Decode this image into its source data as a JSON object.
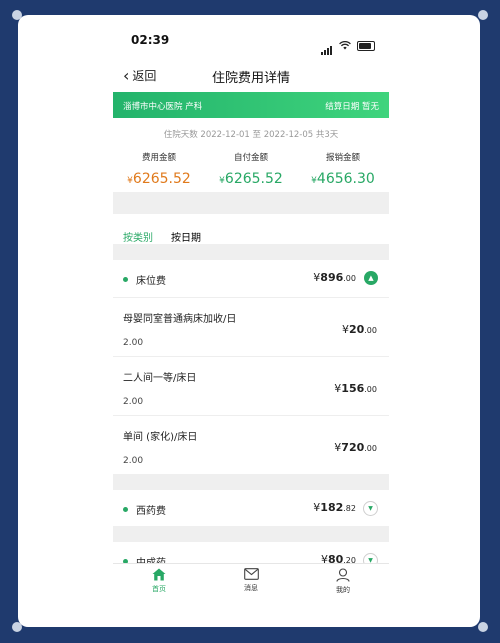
{
  "status": {
    "time": "02:39"
  },
  "nav": {
    "back_label": "返回",
    "title": "住院费用详情"
  },
  "hospital": {
    "name": "淄博市中心医院 产科",
    "settle_label": "结算日期 暂无"
  },
  "stay_info": "住院天数 2022-12-01 至 2022-12-05 共3天",
  "summary": [
    {
      "label": "费用金额",
      "currency": "¥",
      "value": "6265.52",
      "color": "#e07a1c"
    },
    {
      "label": "自付金额",
      "currency": "¥",
      "value": "6265.52",
      "color": "#28a865"
    },
    {
      "label": "报销金额",
      "currency": "¥",
      "value": "4656.30",
      "color": "#28a865"
    }
  ],
  "tabs": [
    {
      "label": "按类别",
      "active": true
    },
    {
      "label": "按日期",
      "active": false
    }
  ],
  "categories": [
    {
      "name": "床位费",
      "currency": "¥",
      "int": "896",
      "dec": ".00",
      "expanded": true,
      "items": [
        {
          "name": "母婴同室普通病床加收/日",
          "qty": "2.00",
          "currency": "¥",
          "int": "20",
          "dec": ".00"
        },
        {
          "name": "二人间一等/床日",
          "qty": "2.00",
          "currency": "¥",
          "int": "156",
          "dec": ".00"
        },
        {
          "name": "单间 (家化)/床日",
          "qty": "2.00",
          "currency": "¥",
          "int": "720",
          "dec": ".00"
        }
      ]
    },
    {
      "name": "西药费",
      "currency": "¥",
      "int": "182",
      "dec": ".82",
      "expanded": false
    },
    {
      "name": "中成药",
      "currency": "¥",
      "int": "80",
      "dec": ".20",
      "expanded": false
    }
  ],
  "tabbar": [
    {
      "label": "首页",
      "icon": "home-icon",
      "active": true
    },
    {
      "label": "消息",
      "icon": "mail-icon",
      "active": false
    },
    {
      "label": "我的",
      "icon": "user-icon",
      "active": false
    }
  ],
  "colors": {
    "accent": "#28a865",
    "orange": "#e07a1c",
    "frame": "#1f3a6e"
  }
}
